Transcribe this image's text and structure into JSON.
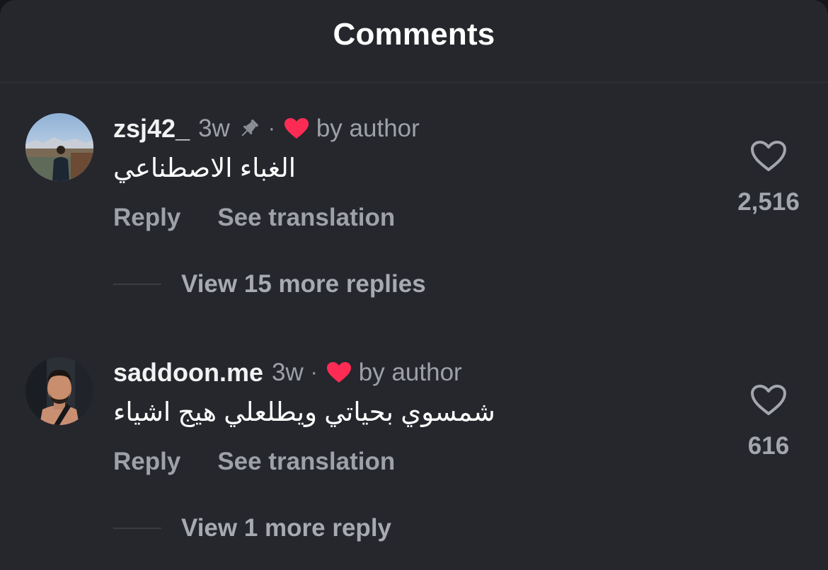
{
  "header": {
    "title": "Comments"
  },
  "comments": [
    {
      "username": "zsj42_",
      "time": "3w",
      "pinned": true,
      "separator": "·",
      "author_label": "by author",
      "text": "الغباء الاصطناعي",
      "reply_label": "Reply",
      "translate_label": "See translation",
      "like_count": "2,516",
      "view_replies": "View 15 more replies",
      "icons": [
        "pin-icon",
        "heart-filled-icon",
        "heart-outline-icon"
      ]
    },
    {
      "username": "saddoon.me",
      "time": "3w",
      "pinned": false,
      "separator": "·",
      "author_label": "by author",
      "text": "شمسوي بحياتي ويطلعلي هيج اشياء",
      "reply_label": "Reply",
      "translate_label": "See translation",
      "like_count": "616",
      "view_replies": "View 1 more reply",
      "icons": [
        "heart-filled-icon",
        "heart-outline-icon"
      ]
    }
  ],
  "colors": {
    "background": "#25272d",
    "primary_text": "#ffffff",
    "secondary_text": "#9ea1a8",
    "author_heart": "#fe2c55"
  }
}
